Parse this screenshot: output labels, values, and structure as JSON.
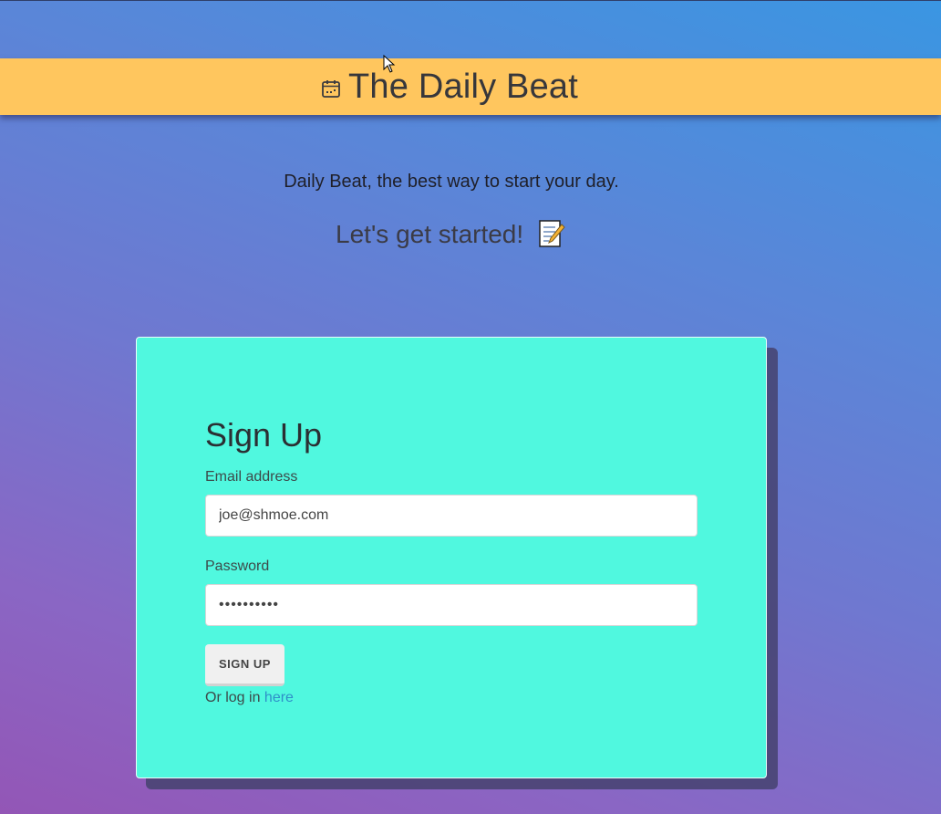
{
  "header": {
    "brand": "The Daily Beat",
    "icon": "calendar-icon"
  },
  "intro": {
    "tagline": "Daily Beat, the best way to start your day.",
    "started": "Let's get started!",
    "started_icon": "memo-icon"
  },
  "form": {
    "title": "Sign Up",
    "email_label": "Email address",
    "email_value": "joe@shmoe.com",
    "password_label": "Password",
    "password_value": "••••••••••",
    "submit_label": "SIGN UP",
    "login_prefix": "Or log in",
    "login_link": "here"
  },
  "colors": {
    "banner": "#ffc65e",
    "card": "#50f8df",
    "link": "#2f8fc8"
  }
}
